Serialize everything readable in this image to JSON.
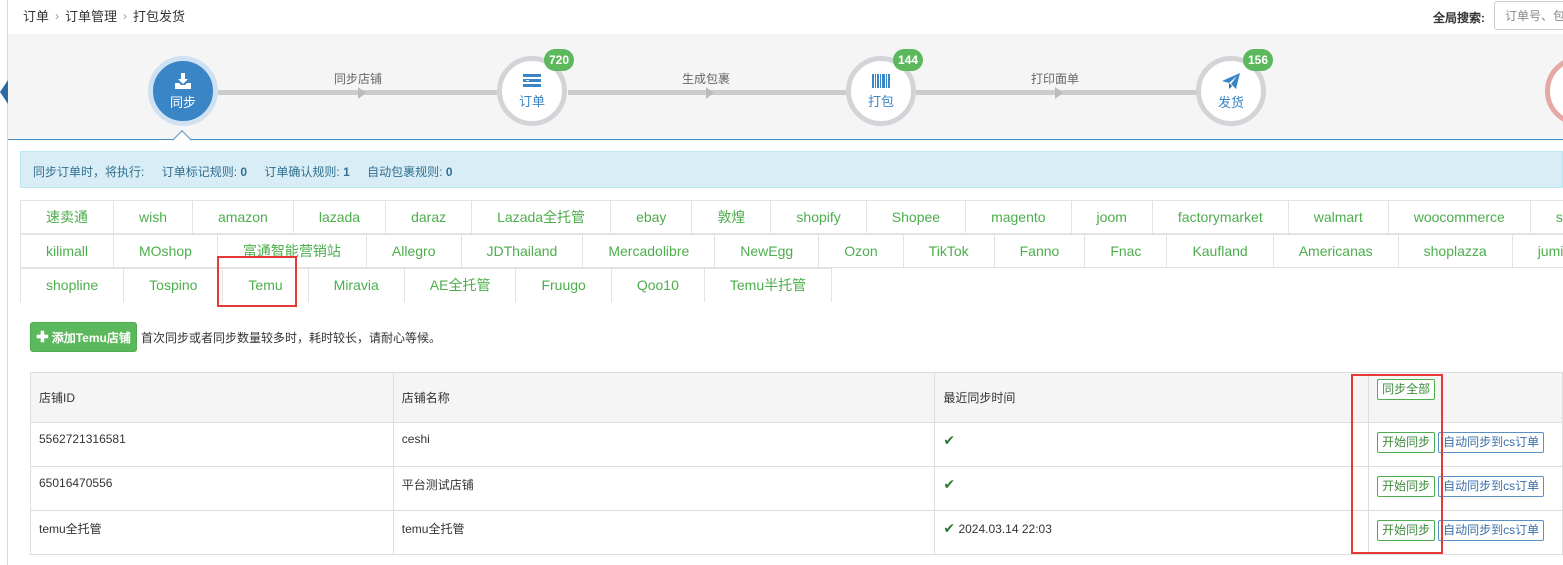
{
  "breadcrumb": [
    "订单",
    "订单管理",
    "打包发货"
  ],
  "global_search": {
    "label": "全局搜索:",
    "placeholder": "订单号、包"
  },
  "workflow": {
    "steps": [
      {
        "label": "同步",
        "badge": ""
      },
      {
        "label": "订单",
        "badge": "720"
      },
      {
        "label": "打包",
        "badge": "144"
      },
      {
        "label": "发货",
        "badge": "156"
      }
    ],
    "captions": [
      "同步店铺",
      "生成包裹",
      "打印面单"
    ]
  },
  "info_bar": {
    "prefix": "同步订单时，将执行:",
    "rule1_label": "订单标记规则:",
    "rule1_value": "0",
    "rule2_label": "订单确认规则:",
    "rule2_value": "1",
    "rule3_label": "自动包裹规则:",
    "rule3_value": "0"
  },
  "platform_tabs": {
    "row1": [
      "速卖通",
      "wish",
      "amazon",
      "lazada",
      "daraz",
      "Lazada全托管",
      "ebay",
      "敦煌",
      "shopify",
      "Shopee",
      "magento",
      "joom",
      "factorymarket",
      "walmart",
      "woocommerce",
      "shopy"
    ],
    "row2": [
      "kilimall",
      "MOshop",
      "富通智能营销站",
      "Allegro",
      "JDThailand",
      "Mercadolibre",
      "NewEgg",
      "Ozon",
      "TikTok",
      "Fanno",
      "Fnac",
      "Kaufland",
      "Americanas",
      "shoplazza",
      "jumia"
    ],
    "row3": [
      "shopline",
      "Tospino",
      "Temu",
      "Miravia",
      "AE全托管",
      "Fruugo",
      "Qoo10",
      "Temu半托管"
    ],
    "selected": "Temu"
  },
  "add_button": "添加Temu店铺",
  "hint": "首次同步或者同步数量较多时，耗时较长，请耐心等候。",
  "table": {
    "headers": [
      "店铺ID",
      "店铺名称",
      "最近同步时间",
      "同步全部"
    ],
    "rows": [
      {
        "id": "5562721316581",
        "name": "ceshi",
        "time": ""
      },
      {
        "id": "65016470556",
        "name": "平台测试店铺",
        "time": ""
      },
      {
        "id": "temu全托管",
        "name": "temu全托管",
        "time": "2024.03.14 22:03"
      }
    ],
    "start_sync_label": "开始同步",
    "auto_sync_label": "自动同步到cs订单"
  },
  "colors": {
    "accent_blue": "#3a85c6",
    "green": "#5cb85c",
    "highlight_red": "#e53935"
  },
  "icons": {
    "sync": "download-icon",
    "orders": "list-icon",
    "pack": "barcode-icon",
    "ship": "paper-plane-icon",
    "ok": "check-icon",
    "add": "plus-icon"
  }
}
